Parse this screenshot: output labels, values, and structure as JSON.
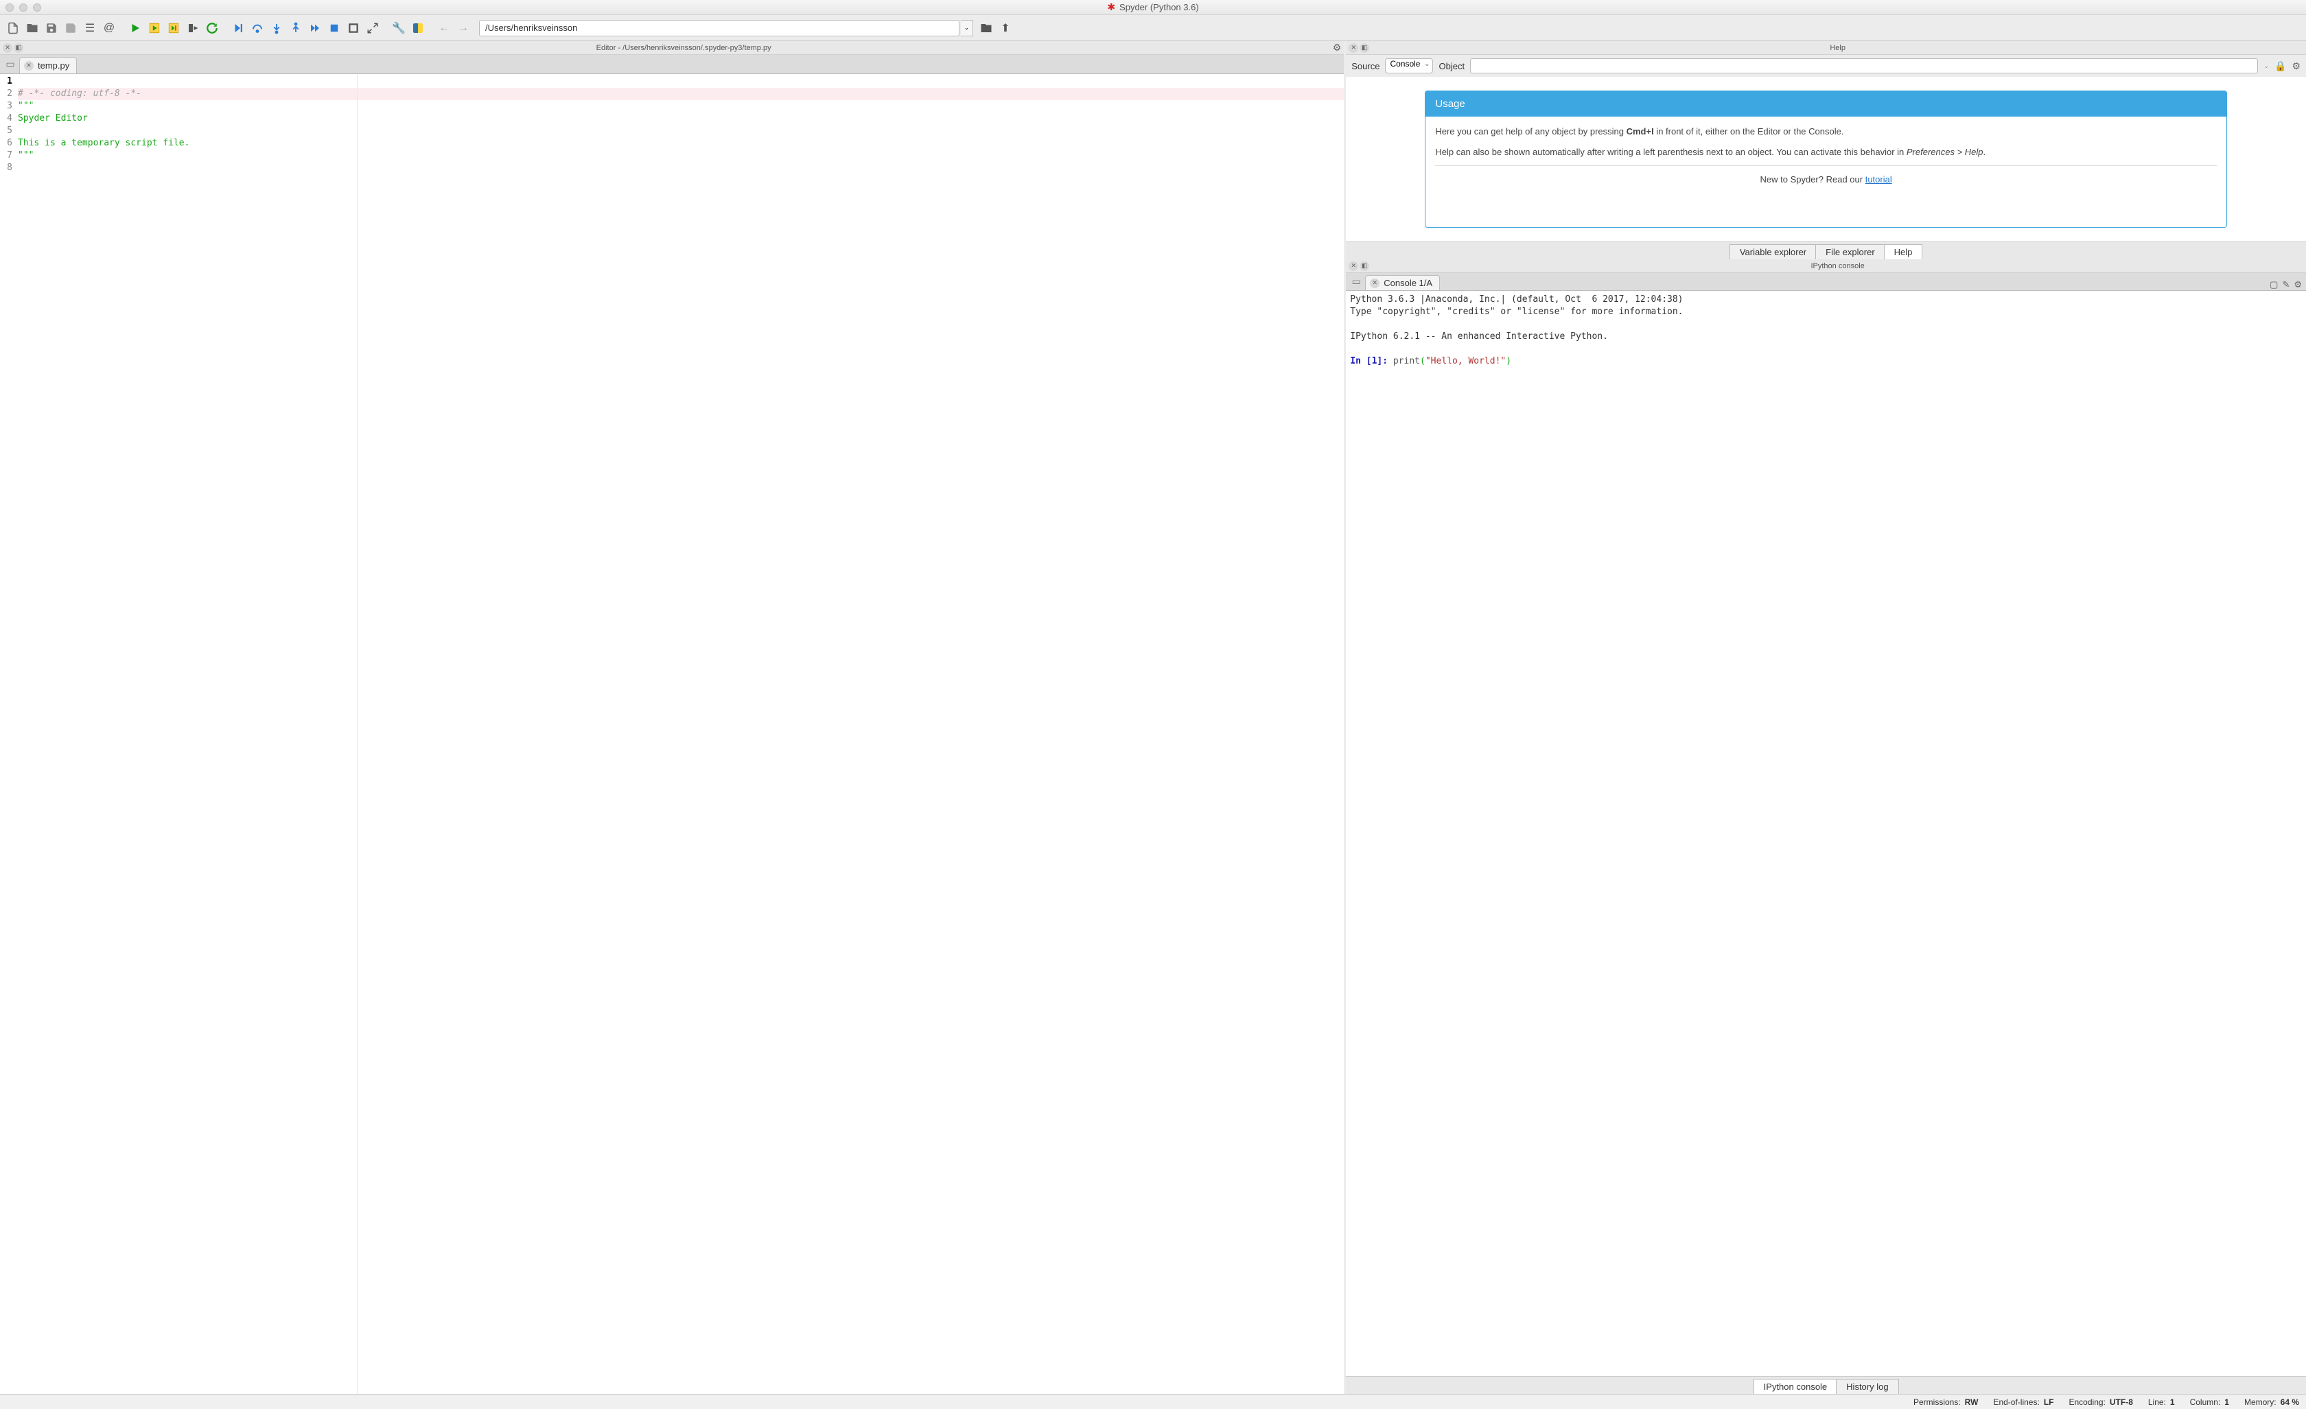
{
  "window": {
    "title": "Spyder (Python 3.6)"
  },
  "toolbar": {
    "cwd": "/Users/henriksveinsson"
  },
  "editor": {
    "pane_title": "Editor - /Users/henriksveinsson/.spyder-py3/temp.py",
    "tab_label": "temp.py",
    "line_numbers": [
      "1",
      "2",
      "3",
      "4",
      "5",
      "6",
      "7",
      "8"
    ],
    "lines": {
      "l1": "# -*- coding: utf-8 -*-",
      "l2": "\"\"\"",
      "l3": "Spyder Editor",
      "l4": "",
      "l5": "This is a temporary script file.",
      "l6": "\"\"\"",
      "l7": "",
      "l8": ""
    }
  },
  "help": {
    "pane_title": "Help",
    "source_label": "Source",
    "source_value": "Console",
    "object_label": "Object",
    "object_value": "",
    "usage_title": "Usage",
    "usage_p1a": "Here you can get help of any object by pressing ",
    "usage_p1_kbd": "Cmd+I",
    "usage_p1b": " in front of it, either on the Editor or the Console.",
    "usage_p2a": "Help can also be shown automatically after writing a left parenthesis next to an object. You can activate this behavior in ",
    "usage_p2_em": "Preferences > Help",
    "usage_p2b": ".",
    "usage_footer_a": "New to Spyder? Read our ",
    "usage_footer_link": "tutorial",
    "tabs": {
      "variable_explorer": "Variable explorer",
      "file_explorer": "File explorer",
      "help": "Help"
    }
  },
  "console": {
    "pane_title": "IPython console",
    "tab_label": "Console 1/A",
    "banner_l1": "Python 3.6.3 |Anaconda, Inc.| (default, Oct  6 2017, 12:04:38)",
    "banner_l2": "Type \"copyright\", \"credits\" or \"license\" for more information.",
    "banner_l3": "",
    "banner_l4": "IPython 6.2.1 -- An enhanced Interactive Python.",
    "prompt": "In [",
    "prompt_num": "1",
    "prompt_end": "]: ",
    "code_func": "print",
    "code_open": "(",
    "code_str": "\"Hello, World!\"",
    "code_close": ")",
    "bottom_tabs": {
      "ipython": "IPython console",
      "history": "History log"
    }
  },
  "statusbar": {
    "perm_label": "Permissions:",
    "perm_val": "RW",
    "eol_label": "End-of-lines:",
    "eol_val": "LF",
    "enc_label": "Encoding:",
    "enc_val": "UTF-8",
    "line_label": "Line:",
    "line_val": "1",
    "col_label": "Column:",
    "col_val": "1",
    "mem_label": "Memory:",
    "mem_val": "64 %"
  }
}
